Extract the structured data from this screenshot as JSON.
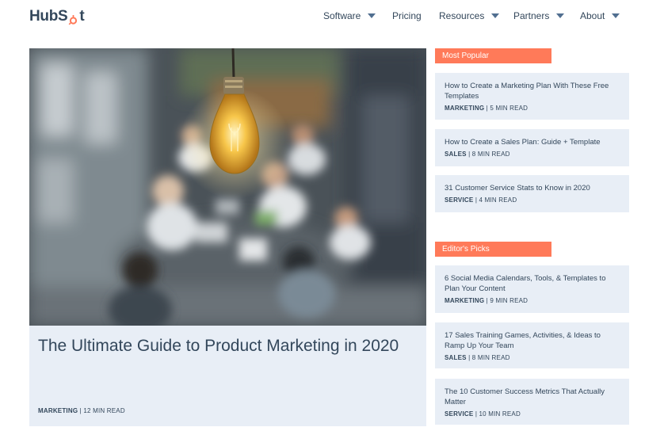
{
  "header": {
    "logo_text_a": "HubS",
    "logo_text_b": "t",
    "nav": [
      {
        "label": "Software",
        "has_menu": true
      },
      {
        "label": "Pricing",
        "has_menu": false
      },
      {
        "label": "Resources",
        "has_menu": true
      },
      {
        "label": "Partners",
        "has_menu": true
      },
      {
        "label": "About",
        "has_menu": true
      }
    ]
  },
  "colors": {
    "accent": "#ff7a59",
    "text": "#33475b",
    "card_bg": "#e8eef6"
  },
  "hero": {
    "title": "The Ultimate Guide to Product Marketing in 2020",
    "category": "MARKETING",
    "read_time": " | 12 MIN READ"
  },
  "most_popular": {
    "label": "Most Popular",
    "items": [
      {
        "title": "How to Create a Marketing Plan With These Free Templates",
        "category": "MARKETING",
        "read_time": " | 5 MIN READ"
      },
      {
        "title": "How to Create a Sales Plan: Guide + Template",
        "category": "SALES",
        "read_time": " | 8 MIN READ"
      },
      {
        "title": "31 Customer Service Stats to Know in 2020",
        "category": "SERVICE",
        "read_time": " | 4 MIN READ"
      }
    ]
  },
  "editors_picks": {
    "label": "Editor's Picks",
    "items": [
      {
        "title": "6 Social Media Calendars, Tools, & Templates to Plan Your Content",
        "category": "MARKETING",
        "read_time": " | 9 MIN READ"
      },
      {
        "title": "17 Sales Training Games, Activities, & Ideas to Ramp Up Your Team",
        "category": "SALES",
        "read_time": " | 8 MIN READ"
      },
      {
        "title": "The 10 Customer Success Metrics That Actually Matter",
        "category": "SERVICE",
        "read_time": " | 10 MIN READ"
      }
    ]
  }
}
